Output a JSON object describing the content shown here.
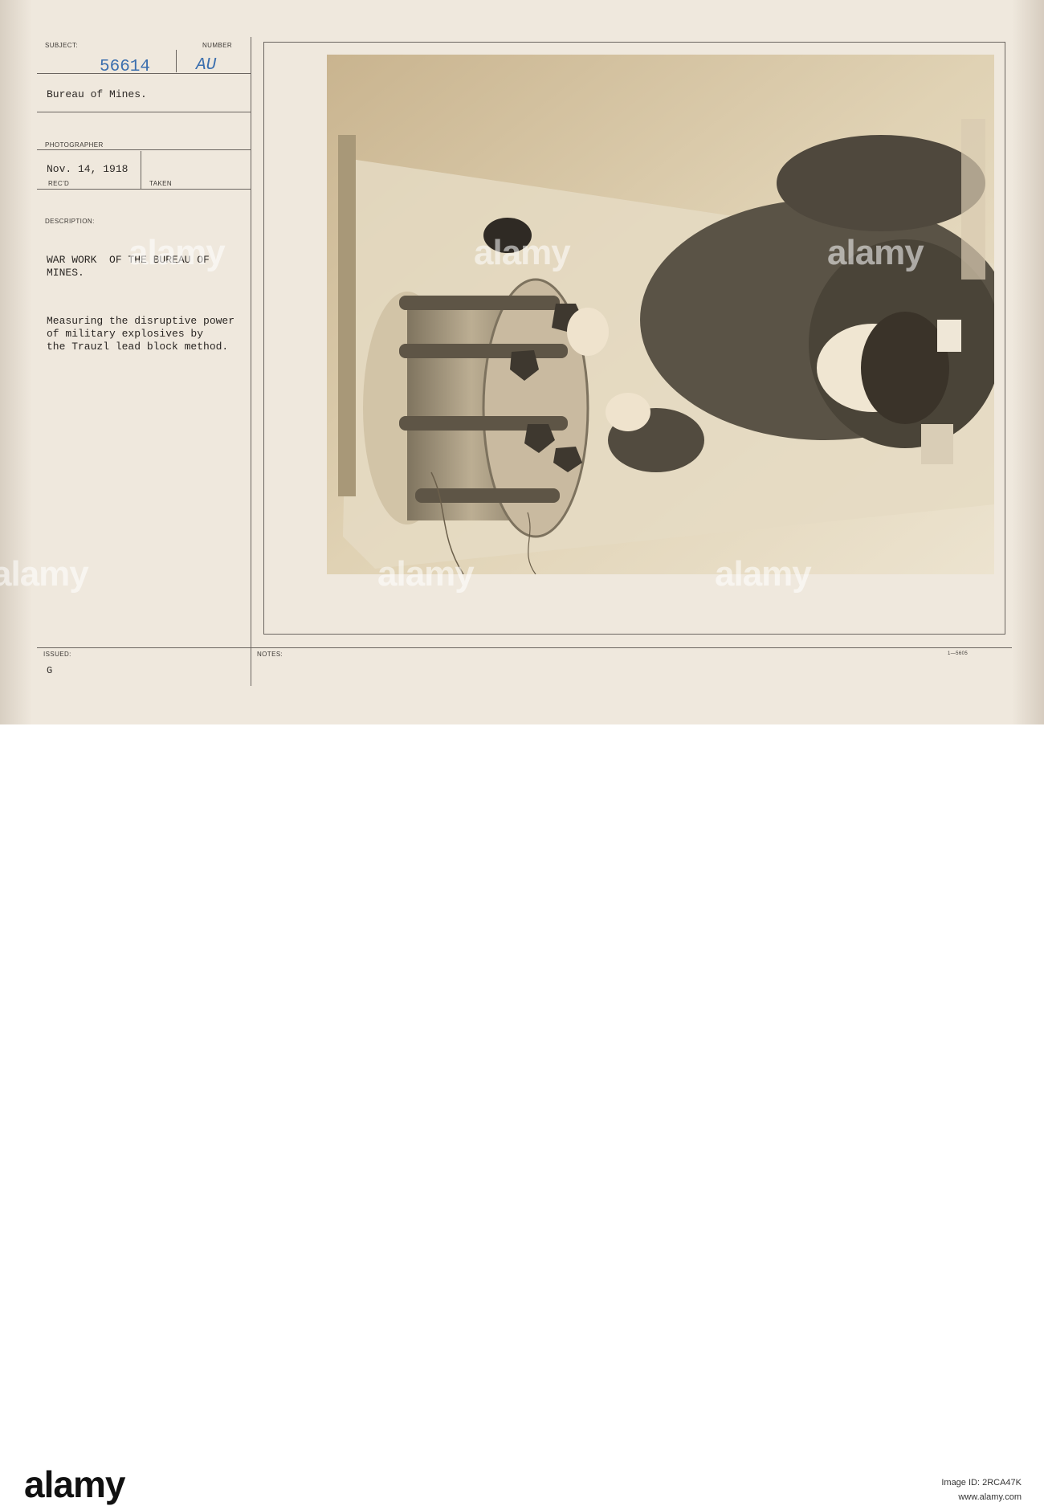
{
  "card": {
    "subject_label": "SUBJECT:",
    "number_label": "NUMBER",
    "subject_number": "56614",
    "number_code": "AU",
    "subject_text": "Bureau of Mines.",
    "photographer_label": "PHOTOGRAPHER",
    "date": "Nov. 14, 1918",
    "recd_label": "REC'D",
    "taken_label": "TAKEN",
    "description_label": "DESCRIPTION:",
    "desc_title_1": "WAR WORK  OF THE BUREAU OF",
    "desc_title_2": "MINES.",
    "desc_line_1": "Measuring the disruptive power",
    "desc_line_2": "of military explosives by",
    "desc_line_3": "the Trauzl lead block method.",
    "issued_label": "ISSUED:",
    "issued_value": "G",
    "notes_label": "NOTES:",
    "form_code": "1—5605"
  },
  "watermark": "alamy",
  "footer": {
    "logo": "alamy",
    "image_id": "Image ID: 2RCA47K",
    "url": "www.alamy.com"
  },
  "colors": {
    "card": "#efe8dd",
    "ink_blue": "#3b6fae",
    "photo_sepia": "#d6c6a4"
  }
}
